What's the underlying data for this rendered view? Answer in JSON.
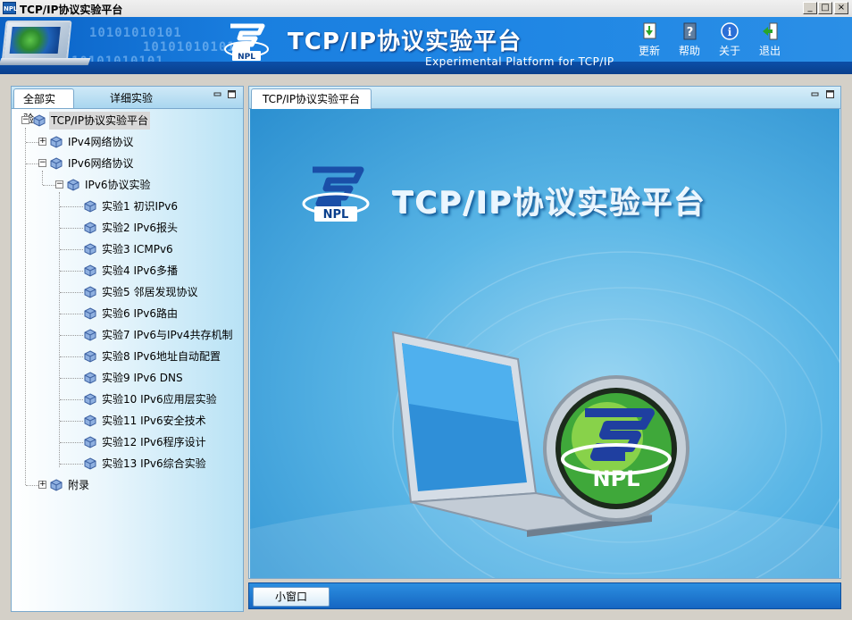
{
  "window": {
    "title": "TCP/IP协议实验平台",
    "icon_text": "NPL",
    "min_glyph": "_",
    "max_glyph": "□",
    "close_glyph": "×"
  },
  "banner": {
    "title": "TCP/IP协议实验平台",
    "subtitle": "Experimental Platform for TCP/IP",
    "logo_text": "NPL",
    "binary_text": "10101010101",
    "toolbar": [
      {
        "label": "更新",
        "icon": "update-icon"
      },
      {
        "label": "帮助",
        "icon": "help-icon"
      },
      {
        "label": "关于",
        "icon": "about-icon"
      },
      {
        "label": "退出",
        "icon": "exit-icon"
      }
    ]
  },
  "left_panel": {
    "tabs": [
      "全部实验",
      "详细实验"
    ],
    "active_tab": 0,
    "tree": {
      "root": "TCP/IP协议实验平台",
      "ipv4": "IPv4网络协议",
      "ipv6": "IPv6网络协议",
      "ipv6_protocol": "IPv6协议实验",
      "experiments": [
        "实验1 初识IPv6",
        "实验2 IPv6报头",
        "实验3 ICMPv6",
        "实验4 IPv6多播",
        "实验5 邻居发现协议",
        "实验6 IPv6路由",
        "实验7 IPv6与IPv4共存机制",
        "实验8 IPv6地址自动配置",
        "实验9 IPv6 DNS",
        "实验10 IPv6应用层实验",
        "实验11 IPv6安全技术",
        "实验12 IPv6程序设计",
        "实验13 IPv6综合实验"
      ],
      "appendix": "附录",
      "plus_glyph": "+",
      "minus_glyph": "−"
    }
  },
  "right_panel": {
    "tab": "TCP/IP协议实验平台",
    "splash_title": "TCP/IP协议实验平台",
    "logo_text": "NPL"
  },
  "statusbar": {
    "button": "小窗口"
  },
  "colors": {
    "banner_blue": "#1a7fe0",
    "panel_border": "#7aa8cc"
  }
}
